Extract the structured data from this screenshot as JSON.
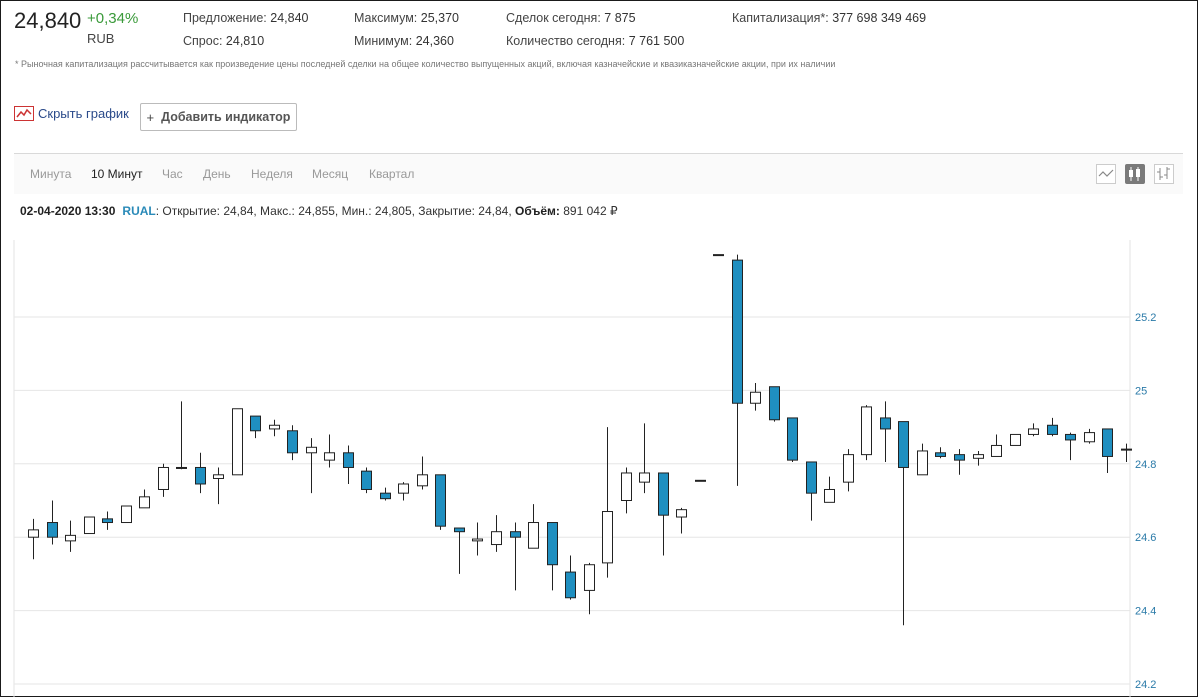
{
  "quote": {
    "price": "24,840",
    "change": "+0,34%",
    "currency": "RUB"
  },
  "stats": {
    "offer_label": "Предложение:",
    "offer_value": "24,840",
    "bid_label": "Спрос:",
    "bid_value": "24,810",
    "high_label": "Максимум:",
    "high_value": "25,370",
    "low_label": "Минимум:",
    "low_value": "24,360",
    "trades_label": "Сделок сегодня:",
    "trades_value": "7 875",
    "qty_label": "Количество сегодня:",
    "qty_value": "7 761 500",
    "cap_label": "Капитализация*:",
    "cap_value": "377 698 349 469"
  },
  "footnote": "* Рыночная капитализация рассчитывается как произведение цены последней сделки на общее количество выпущенных акций, включая казначейские и квазиказначейские акции, при их наличии",
  "controls": {
    "hide_chart_label": "Скрыть график",
    "add_indicator_label": "Добавить индикатор"
  },
  "tabs": [
    "Минута",
    "10 Минут",
    "Час",
    "День",
    "Неделя",
    "Месяц",
    "Квартал"
  ],
  "active_tab": "10 Минут",
  "toolbar_icons": [
    "line-chart-icon",
    "candlestick-icon",
    "ohlc-bars-icon"
  ],
  "info": {
    "datetime": "02-04-2020 13:30",
    "ticker": "RUAL",
    "ohlc_text": ": Открытие: 24,84, Макс.: 24,855, Мин.: 24,805, Закрытие: 24,84,",
    "volume_label": "Объём:",
    "volume_value": "891 042 ₽"
  },
  "colors": {
    "bear_fill": "#1f8fc0",
    "bull_fill": "#ffffff",
    "candle_stroke": "#222222",
    "grid": "#e6e6e6",
    "tick_label": "#2a7aa8",
    "change_positive": "#3a9a3a"
  },
  "chart_data": {
    "type": "candlestick",
    "ylim": [
      24.2,
      25.4
    ],
    "yticks": [
      25.2,
      25.0,
      24.8,
      24.6,
      24.4,
      24.2
    ],
    "ytick_labels": [
      "25.2",
      "25",
      "24.8",
      "24.6",
      "24.4",
      "24.2"
    ],
    "candles": [
      {
        "o": 24.6,
        "h": 24.65,
        "l": 24.54,
        "c": 24.62
      },
      {
        "o": 24.64,
        "h": 24.7,
        "l": 24.58,
        "c": 24.6
      },
      {
        "o": 24.59,
        "h": 24.645,
        "l": 24.56,
        "c": 24.605
      },
      {
        "o": 24.61,
        "h": 24.655,
        "l": 24.61,
        "c": 24.655
      },
      {
        "o": 24.65,
        "h": 24.67,
        "l": 24.62,
        "c": 24.64
      },
      {
        "o": 24.64,
        "h": 24.685,
        "l": 24.64,
        "c": 24.685
      },
      {
        "o": 24.68,
        "h": 24.73,
        "l": 24.68,
        "c": 24.71
      },
      {
        "o": 24.73,
        "h": 24.8,
        "l": 24.71,
        "c": 24.79
      },
      {
        "o": 24.79,
        "h": 24.97,
        "l": 24.785,
        "c": 24.79
      },
      {
        "o": 24.79,
        "h": 24.83,
        "l": 24.72,
        "c": 24.745
      },
      {
        "o": 24.76,
        "h": 24.79,
        "l": 24.69,
        "c": 24.77
      },
      {
        "o": 24.77,
        "h": 24.95,
        "l": 24.77,
        "c": 24.95
      },
      {
        "o": 24.93,
        "h": 24.93,
        "l": 24.87,
        "c": 24.89
      },
      {
        "o": 24.895,
        "h": 24.92,
        "l": 24.875,
        "c": 24.905
      },
      {
        "o": 24.89,
        "h": 24.905,
        "l": 24.81,
        "c": 24.83
      },
      {
        "o": 24.83,
        "h": 24.87,
        "l": 24.72,
        "c": 24.845
      },
      {
        "o": 24.81,
        "h": 24.88,
        "l": 24.79,
        "c": 24.83
      },
      {
        "o": 24.83,
        "h": 24.85,
        "l": 24.745,
        "c": 24.79
      },
      {
        "o": 24.78,
        "h": 24.79,
        "l": 24.72,
        "c": 24.73
      },
      {
        "o": 24.72,
        "h": 24.735,
        "l": 24.7,
        "c": 24.705
      },
      {
        "o": 24.72,
        "h": 24.75,
        "l": 24.7,
        "c": 24.745
      },
      {
        "o": 24.74,
        "h": 24.82,
        "l": 24.73,
        "c": 24.77
      },
      {
        "o": 24.77,
        "h": 24.77,
        "l": 24.62,
        "c": 24.63
      },
      {
        "o": 24.625,
        "h": 24.62,
        "l": 24.5,
        "c": 24.615
      },
      {
        "o": 24.59,
        "h": 24.64,
        "l": 24.55,
        "c": 24.595
      },
      {
        "o": 24.58,
        "h": 24.66,
        "l": 24.56,
        "c": 24.615
      },
      {
        "o": 24.615,
        "h": 24.64,
        "l": 24.455,
        "c": 24.6
      },
      {
        "o": 24.57,
        "h": 24.69,
        "l": 24.57,
        "c": 24.64
      },
      {
        "o": 24.64,
        "h": 24.64,
        "l": 24.455,
        "c": 24.525
      },
      {
        "o": 24.505,
        "h": 24.55,
        "l": 24.43,
        "c": 24.435
      },
      {
        "o": 24.455,
        "h": 24.53,
        "l": 24.39,
        "c": 24.525
      },
      {
        "o": 24.53,
        "h": 24.9,
        "l": 24.49,
        "c": 24.67
      },
      {
        "o": 24.7,
        "h": 24.79,
        "l": 24.665,
        "c": 24.775
      },
      {
        "o": 24.75,
        "h": 24.91,
        "l": 24.72,
        "c": 24.775
      },
      {
        "o": 24.775,
        "h": 24.775,
        "l": 24.55,
        "c": 24.66
      },
      {
        "o": 24.655,
        "h": 24.68,
        "l": 24.61,
        "c": 24.675
      },
      {
        "o": 24.755,
        "h": 24.755,
        "l": 24.755,
        "c": 24.755
      },
      {
        "o": 25.37,
        "h": 25.37,
        "l": 25.37,
        "c": 25.37
      },
      {
        "o": 25.355,
        "h": 25.37,
        "l": 24.74,
        "c": 24.965
      },
      {
        "o": 24.965,
        "h": 25.02,
        "l": 24.945,
        "c": 24.995
      },
      {
        "o": 25.01,
        "h": 25.01,
        "l": 24.915,
        "c": 24.92
      },
      {
        "o": 24.925,
        "h": 24.925,
        "l": 24.805,
        "c": 24.81
      },
      {
        "o": 24.805,
        "h": 24.805,
        "l": 24.645,
        "c": 24.72
      },
      {
        "o": 24.695,
        "h": 24.765,
        "l": 24.695,
        "c": 24.73
      },
      {
        "o": 24.75,
        "h": 24.84,
        "l": 24.725,
        "c": 24.825
      },
      {
        "o": 24.825,
        "h": 24.96,
        "l": 24.81,
        "c": 24.955
      },
      {
        "o": 24.925,
        "h": 24.97,
        "l": 24.805,
        "c": 24.895
      },
      {
        "o": 24.915,
        "h": 24.915,
        "l": 24.36,
        "c": 24.79
      },
      {
        "o": 24.77,
        "h": 24.855,
        "l": 24.77,
        "c": 24.835
      },
      {
        "o": 24.83,
        "h": 24.845,
        "l": 24.815,
        "c": 24.82
      },
      {
        "o": 24.825,
        "h": 24.84,
        "l": 24.77,
        "c": 24.81
      },
      {
        "o": 24.815,
        "h": 24.835,
        "l": 24.795,
        "c": 24.825
      },
      {
        "o": 24.82,
        "h": 24.88,
        "l": 24.82,
        "c": 24.85
      },
      {
        "o": 24.85,
        "h": 24.88,
        "l": 24.85,
        "c": 24.88
      },
      {
        "o": 24.88,
        "h": 24.91,
        "l": 24.875,
        "c": 24.895
      },
      {
        "o": 24.905,
        "h": 24.925,
        "l": 24.875,
        "c": 24.88
      },
      {
        "o": 24.88,
        "h": 24.885,
        "l": 24.81,
        "c": 24.865
      },
      {
        "o": 24.86,
        "h": 24.895,
        "l": 24.855,
        "c": 24.885
      },
      {
        "o": 24.895,
        "h": 24.895,
        "l": 24.775,
        "c": 24.82
      },
      {
        "o": 24.84,
        "h": 24.855,
        "l": 24.805,
        "c": 24.84
      }
    ]
  }
}
